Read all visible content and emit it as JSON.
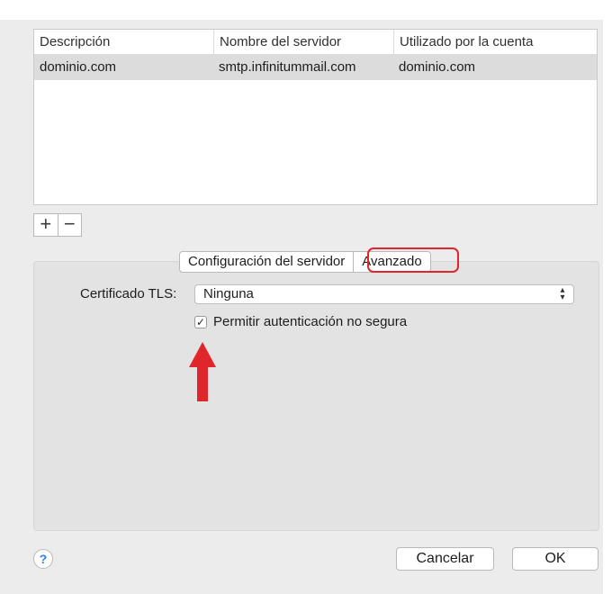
{
  "table": {
    "columns": [
      "Descripción",
      "Nombre del servidor",
      "Utilizado por la cuenta"
    ],
    "rows": [
      [
        "dominio.com",
        "smtp.infinitummail.com",
        "dominio.com"
      ]
    ]
  },
  "controls": {
    "add": "+",
    "remove": "−"
  },
  "tabs": {
    "server_config": "Configuración del servidor",
    "advanced": "Avanzado",
    "selected": "Avanzado"
  },
  "advanced": {
    "tls_label": "Certificado TLS:",
    "tls_value": "Ninguna",
    "allow_insecure_label": "Permitir autenticación no segura",
    "allow_insecure_checked": true
  },
  "footer": {
    "help": "?",
    "cancel": "Cancelar",
    "ok": "OK"
  },
  "annotations": {
    "highlight_color": "#e0262b",
    "arrow_color": "#e0262b"
  }
}
